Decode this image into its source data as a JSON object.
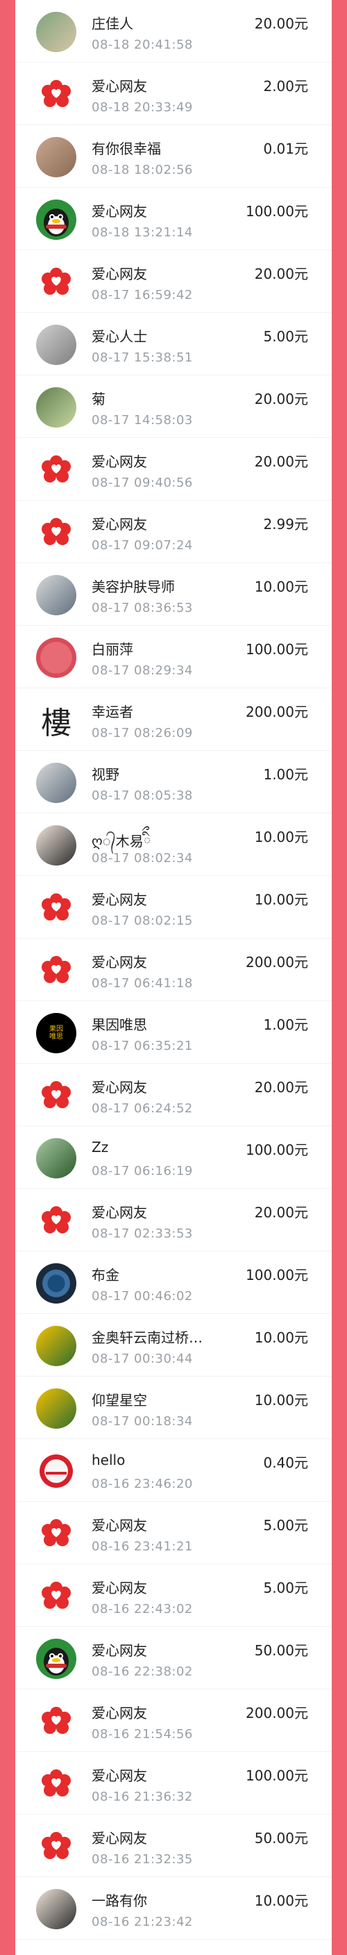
{
  "colors": {
    "page_bg": "#f0616f",
    "panel_bg": "#ffffff",
    "name_text": "#222222",
    "time_text": "#9aa0a6",
    "amount_text": "#222222"
  },
  "donations": [
    {
      "name": "庄佳人",
      "time": "08-18 20:41:58",
      "amount": "20.00元",
      "avatar_icon": "dog-photo-icon"
    },
    {
      "name": "爱心网友",
      "time": "08-18 20:33:49",
      "amount": "2.00元",
      "avatar_icon": "red-heart-flower-icon"
    },
    {
      "name": "有你很幸福",
      "time": "08-18 18:02:56",
      "amount": "0.01元",
      "avatar_icon": "photo-icon"
    },
    {
      "name": "爱心网友",
      "time": "08-18 13:21:14",
      "amount": "100.00元",
      "avatar_icon": "qq-penguin-icon"
    },
    {
      "name": "爱心网友",
      "time": "08-17 16:59:42",
      "amount": "20.00元",
      "avatar_icon": "red-heart-flower-icon"
    },
    {
      "name": "爱心人士",
      "time": "08-17 15:38:51",
      "amount": "5.00元",
      "avatar_icon": "person-photo-icon"
    },
    {
      "name": "菊",
      "time": "08-17 14:58:03",
      "amount": "20.00元",
      "avatar_icon": "nature-photo-icon"
    },
    {
      "name": "爱心网友",
      "time": "08-17 09:40:56",
      "amount": "20.00元",
      "avatar_icon": "red-heart-flower-icon"
    },
    {
      "name": "爱心网友",
      "time": "08-17 09:07:24",
      "amount": "2.99元",
      "avatar_icon": "red-heart-flower-icon"
    },
    {
      "name": "美容护肤导师",
      "time": "08-17 08:36:53",
      "amount": "10.00元",
      "avatar_icon": "people-photo-icon"
    },
    {
      "name": "白丽萍",
      "time": "08-17 08:29:34",
      "amount": "100.00元",
      "avatar_icon": "red-circle-icon"
    },
    {
      "name": "幸运者",
      "time": "08-17 08:26:09",
      "amount": "200.00元",
      "avatar_icon": "calligraphy-icon",
      "avatar_text": "樓"
    },
    {
      "name": "视野",
      "time": "08-17 08:05:38",
      "amount": "1.00元",
      "avatar_icon": "landscape-photo-icon"
    },
    {
      "name": "ღ᭄木易ིྀ",
      "time": "08-17 08:02:34",
      "amount": "10.00元",
      "avatar_icon": "portrait-photo-icon"
    },
    {
      "name": "爱心网友",
      "time": "08-17 08:02:15",
      "amount": "10.00元",
      "avatar_icon": "red-heart-flower-icon"
    },
    {
      "name": "爱心网友",
      "time": "08-17 06:41:18",
      "amount": "200.00元",
      "avatar_icon": "red-heart-flower-icon"
    },
    {
      "name": "果因唯思",
      "time": "08-17 06:35:21",
      "amount": "1.00元",
      "avatar_icon": "black-logo-icon",
      "avatar_text": "果因\n唯思"
    },
    {
      "name": "爱心网友",
      "time": "08-17 06:24:52",
      "amount": "20.00元",
      "avatar_icon": "red-heart-flower-icon"
    },
    {
      "name": "Zz",
      "time": "08-17 06:16:19",
      "amount": "100.00元",
      "avatar_icon": "field-photo-icon"
    },
    {
      "name": "爱心网友",
      "time": "08-17 02:33:53",
      "amount": "20.00元",
      "avatar_icon": "red-heart-flower-icon"
    },
    {
      "name": "布金",
      "time": "08-17 00:46:02",
      "amount": "100.00元",
      "avatar_icon": "mandala-icon"
    },
    {
      "name": "金奥轩云南过桥…",
      "time": "08-17 00:30:44",
      "amount": "10.00元",
      "avatar_icon": "food-photo-icon"
    },
    {
      "name": "仰望星空",
      "time": "08-17 00:18:34",
      "amount": "10.00元",
      "avatar_icon": "sunflower-photo-icon"
    },
    {
      "name": "hello",
      "time": "08-16 23:46:20",
      "amount": "0.40元",
      "avatar_icon": "red-seal-icon"
    },
    {
      "name": "爱心网友",
      "time": "08-16 23:41:21",
      "amount": "5.00元",
      "avatar_icon": "red-heart-flower-icon"
    },
    {
      "name": "爱心网友",
      "time": "08-16 22:43:02",
      "amount": "5.00元",
      "avatar_icon": "red-heart-flower-icon"
    },
    {
      "name": "爱心网友",
      "time": "08-16 22:38:02",
      "amount": "50.00元",
      "avatar_icon": "qq-penguin-icon"
    },
    {
      "name": "爱心网友",
      "time": "08-16 21:54:56",
      "amount": "200.00元",
      "avatar_icon": "red-heart-flower-icon"
    },
    {
      "name": "爱心网友",
      "time": "08-16 21:36:32",
      "amount": "100.00元",
      "avatar_icon": "red-heart-flower-icon"
    },
    {
      "name": "爱心网友",
      "time": "08-16 21:32:35",
      "amount": "50.00元",
      "avatar_icon": "red-heart-flower-icon"
    },
    {
      "name": "一路有你",
      "time": "08-16 21:23:42",
      "amount": "10.00元",
      "avatar_icon": "woman-portrait-icon"
    }
  ]
}
